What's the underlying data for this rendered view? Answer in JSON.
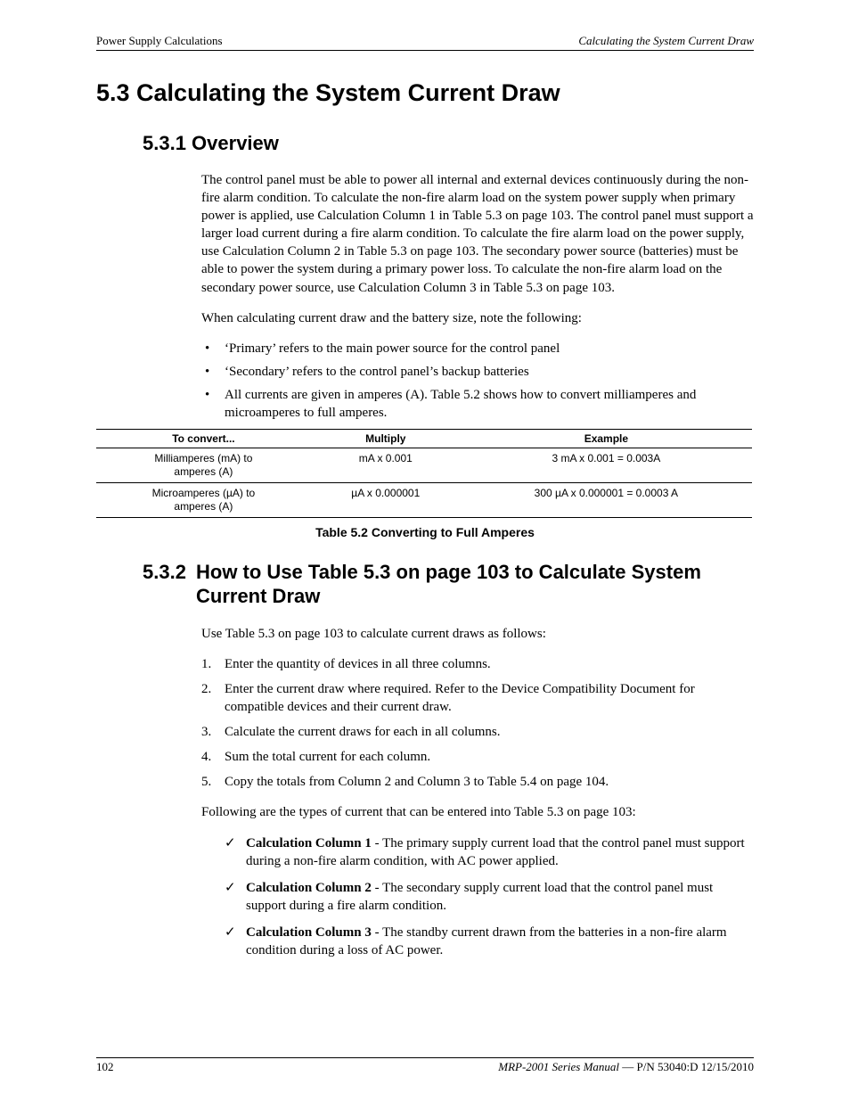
{
  "header": {
    "left": "Power Supply Calculations",
    "right": "Calculating the System Current Draw"
  },
  "section": {
    "number_title": "5.3  Calculating the System Current Draw",
    "sub1": {
      "title": "5.3.1  Overview",
      "para1": "The control panel must be able to power all internal and external devices continuously during the non-fire alarm condition.  To calculate the non-fire alarm load on the system power supply when primary power is applied, use Calculation Column 1 in Table 5.3 on page 103.  The control panel must support a larger load current during a fire alarm condition.  To calculate the fire alarm load on the power supply, use Calculation Column 2 in Table 5.3 on page 103.  The secondary power source (batteries) must be able to power the system during a primary power loss.  To calculate the non-fire alarm load on the secondary power source, use Calculation Column 3 in Table 5.3 on page 103.",
      "para2": "When calculating current draw and the battery size, note the following:",
      "bullets": [
        "‘Primary’ refers to the main power source for the control panel",
        "‘Secondary’ refers to the control panel’s backup batteries",
        "All currents are given in amperes (A).  Table 5.2  shows how to convert milliamperes and microamperes to full amperes."
      ]
    },
    "table52": {
      "headers": [
        "To convert...",
        "Multiply",
        "Example"
      ],
      "rows": [
        [
          "Milliamperes (mA) to\namperes (A)",
          "mA x 0.001",
          "3 mA x 0.001 = 0.003A"
        ],
        [
          "Microamperes (µA) to\namperes (A)",
          "µA x 0.000001",
          "300 µA x 0.000001 = 0.0003 A"
        ]
      ],
      "caption": "Table 5.2  Converting to Full Amperes"
    },
    "sub2": {
      "number": "5.3.2",
      "title": "How to Use Table 5.3 on page 103 to Calculate System Current Draw",
      "para1": "Use Table 5.3 on page 103 to calculate current draws as follows:",
      "steps": [
        "Enter the quantity of devices in all three columns.",
        "Enter the current draw where required.  Refer to the Device Compatibility Document for compatible devices and their current draw.",
        "Calculate the current draws for each in all columns.",
        "Sum the total current for each column.",
        "Copy the totals from Column 2 and Column 3 to Table 5.4 on page 104."
      ],
      "para2": "Following are the types of current that can be entered into Table 5.3 on page 103:",
      "checks": [
        {
          "label": "Calculation Column 1",
          "text": " - The primary supply current load that the control panel must support during a non-fire alarm condition, with AC power applied."
        },
        {
          "label": "Calculation Column 2",
          "text": " - The secondary supply current load that the control panel must support during a fire alarm condition."
        },
        {
          "label": "Calculation Column 3",
          "text": " - The standby current drawn from the batteries in a non-fire alarm condition during a loss of AC power."
        }
      ]
    }
  },
  "footer": {
    "page": "102",
    "doc_title": "MRP-2001 Series Manual",
    "sep": " — ",
    "pn": "P/N 53040:D  12/15/2010"
  }
}
